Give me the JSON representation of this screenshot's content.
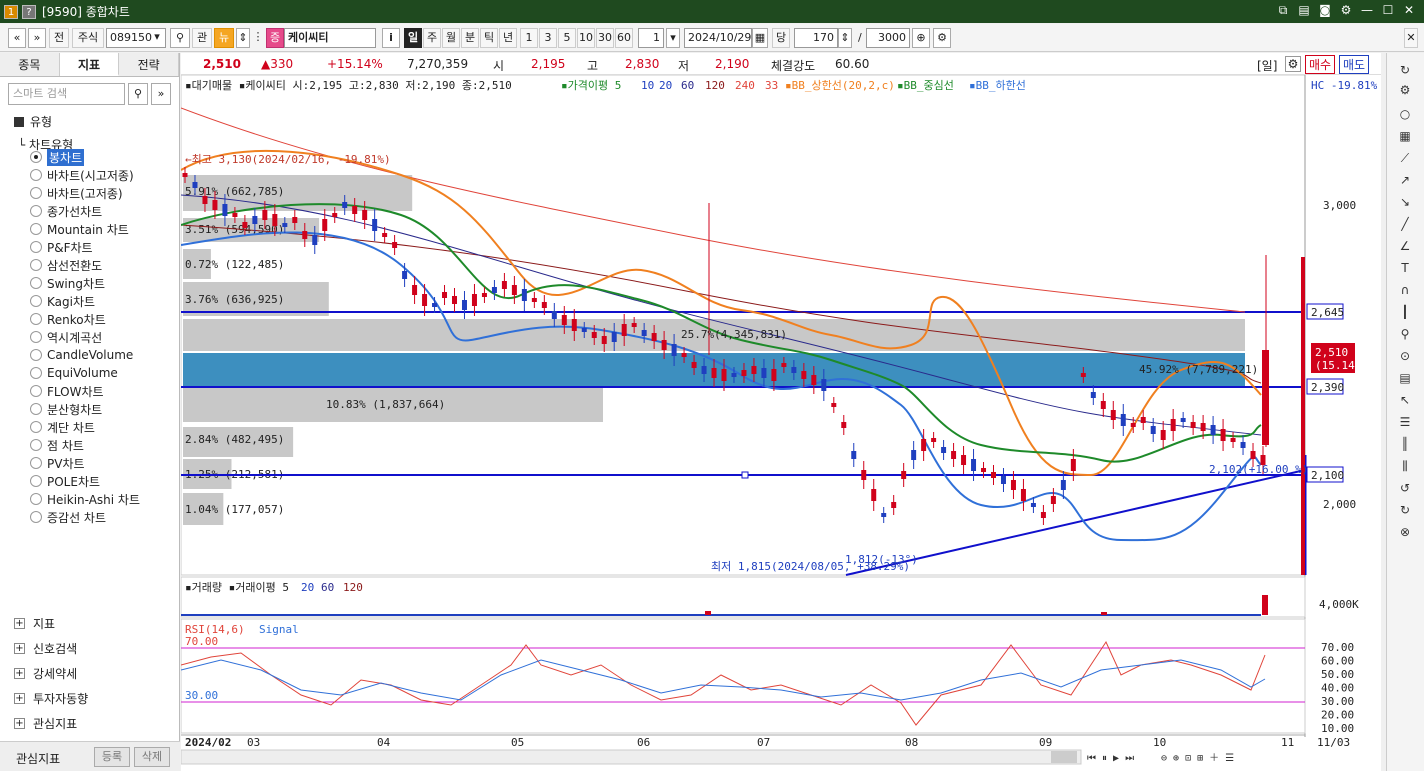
{
  "window": {
    "title": "[9590] 종합차트"
  },
  "toolbar": {
    "stock_type": "주식",
    "code": "089150",
    "btn_jeon": "전",
    "btn_gwan": "관",
    "btn_new": "뉴",
    "badge_jeung": "증",
    "stock_name": "케이씨티",
    "info_btn": "i",
    "periods": [
      "일",
      "주",
      "월",
      "분",
      "틱",
      "년"
    ],
    "intervals": [
      "1",
      "3",
      "5",
      "10",
      "30",
      "60"
    ],
    "interval_value": "1",
    "date": "2024/10/29",
    "dang_label": "당",
    "count": "170",
    "slash": "/",
    "total": "3000"
  },
  "left_panel": {
    "tabs": [
      "종목",
      "지표",
      "전략"
    ],
    "search_placeholder": "스마트 검색",
    "tree_head": "유형",
    "tree_sub": "차트유형",
    "chart_types": [
      "봉차트",
      "바차트(시고저종)",
      "바차트(고저종)",
      "종가선차트",
      "Mountain 차트",
      "P&F차트",
      "삼선전환도",
      "Swing차트",
      "Kagi차트",
      "Renko차트",
      "역시계곡선",
      "CandleVolume",
      "EquiVolume",
      "FLOW차트",
      "분산형차트",
      "계단 차트",
      "점 차트",
      "PV차트",
      "POLE차트",
      "Heikin-Ashi 차트",
      "증감선 차트"
    ],
    "sections": [
      "지표",
      "신호검색",
      "강세약세",
      "투자자동향",
      "관심지표"
    ],
    "footer_label": "관심지표",
    "footer_btn_add": "등록",
    "footer_btn_del": "삭제"
  },
  "quote": {
    "price": "2,510",
    "change": "▲330",
    "change_pct": "+15.14%",
    "volume": "7,270,359",
    "open_label": "시",
    "open": "2,195",
    "high_label": "고",
    "high": "2,830",
    "low_label": "저",
    "low": "2,190",
    "strength_label": "체결강도",
    "strength": "60.60",
    "period_tag": "[일]",
    "buy_btn": "매수",
    "sell_btn": "매도"
  },
  "chart": {
    "legend_main": "▪대기매물 ▪케이씨티 시:2,195 고:2,830 저:2,190 종:2,510",
    "legend_ma_label": "▪가격이평 5",
    "legend_ma": [
      "10",
      "20",
      "60",
      "120",
      "240",
      "33"
    ],
    "legend_bb": [
      "▪BB_상한선(20,2,c)",
      "▪BB_중심선",
      "▪BB_하한선"
    ],
    "hc_label": "HC -19.81%",
    "y_ticks": [
      "3,000",
      "2,000"
    ],
    "y_labels": {
      "hline1": "2,645",
      "hline2": "2,390",
      "hline3": "2,100",
      "current": "2,510",
      "current_pct": "(15.14%)"
    },
    "annotations": {
      "high_note": "←최고 3,130(2024/02/16, -19.81%)",
      "low_note": "최저 1,815(2024/08/05, +38.29%)",
      "bar_note_top": "45.92% (7,789,221)",
      "bar_note_mid": "25.7%(4,345,831)",
      "trend_note": "2,102(+16.00 %)",
      "angle_note": "1,812(-13°)"
    },
    "supply_bars": [
      {
        "label": "5.91% (662,785)"
      },
      {
        "label": "3.51% (594,590)"
      },
      {
        "label": "0.72% (122,485)"
      },
      {
        "label": "3.76% (636,925)"
      },
      {
        "label": "10.83% (1,837,664)"
      },
      {
        "label": "2.84% (482,495)"
      },
      {
        "label": "1.25% (212,581)"
      },
      {
        "label": "1.04% (177,057)"
      }
    ],
    "volume_legend": "▪거래량 ▪거래이평 5",
    "volume_legend_ma": [
      "20",
      "60",
      "120"
    ],
    "volume_tick": "4,000K",
    "rsi_legend": "RSI(14,6)",
    "rsi_signal": "Signal",
    "rsi_lines": [
      "70.00",
      "30.00"
    ],
    "rsi_ticks": [
      "70.00",
      "60.00",
      "50.00",
      "40.00",
      "30.00",
      "20.00",
      "10.00"
    ],
    "x_labels": [
      "2024/02",
      "03",
      "04",
      "05",
      "06",
      "07",
      "08",
      "09",
      "10",
      "11"
    ],
    "x_date_right": "11/03"
  },
  "chart_data": {
    "type": "candlestick",
    "title": "케이씨티",
    "y_range": [
      1700,
      3300
    ],
    "horizontal_lines": [
      2645,
      2390,
      2100
    ],
    "ohlc_summary": {
      "open": 2195,
      "high": 2830,
      "low": 2190,
      "close": 2510
    },
    "high": {
      "value": 3130,
      "date": "2024/02/16"
    },
    "low": {
      "value": 1815,
      "date": "2024/08/05"
    },
    "supply_pct": [
      5.91,
      3.51,
      0.72,
      3.76,
      45.92,
      10.83,
      2.84,
      1.25,
      1.04
    ],
    "x_months": [
      "2024/02",
      "03",
      "04",
      "05",
      "06",
      "07",
      "08",
      "09",
      "10",
      "11"
    ],
    "rsi_range": [
      10,
      70
    ]
  }
}
